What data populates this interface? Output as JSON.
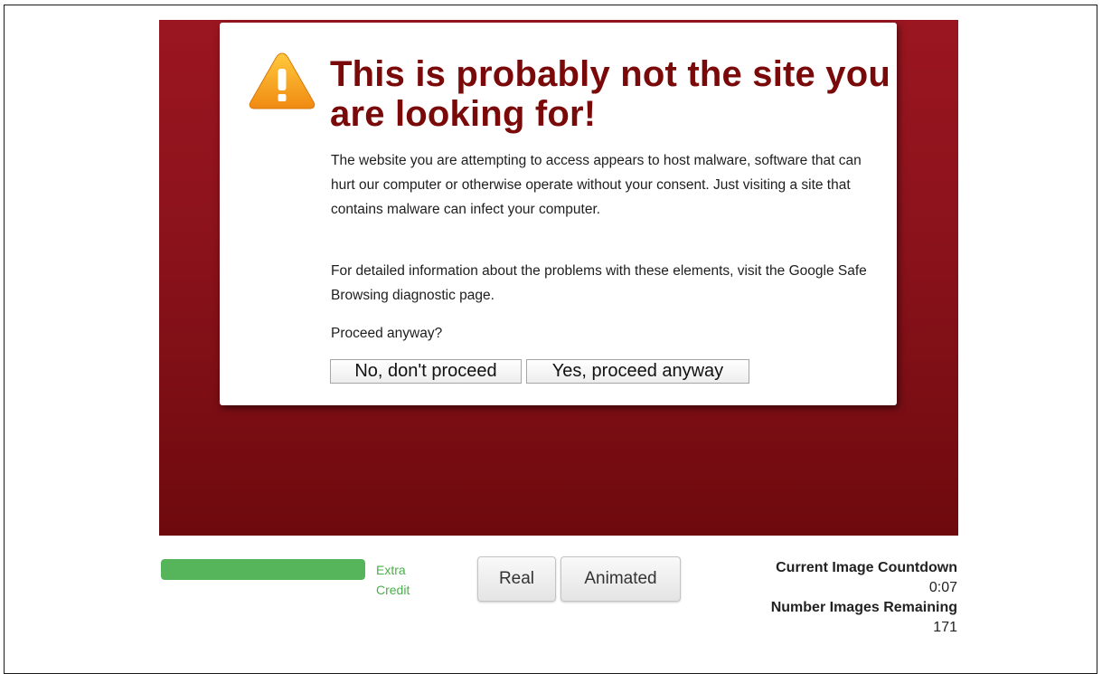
{
  "warning": {
    "headline": "This is probably not the site you are looking for!",
    "paragraph1": "The website you are attempting to access appears to host malware, software that can hurt our computer or otherwise operate without your consent. Just visiting a site that contains malware can infect your computer.",
    "paragraph2": "For detailed information about the problems with these elements, visit the Google Safe Browsing diagnostic page.",
    "question": "Proceed anyway?",
    "no_button": "No, don't proceed",
    "yes_button": "Yes, proceed anyway"
  },
  "colors": {
    "background_red": "#8a121b",
    "headline": "#7a0a0a",
    "progress_green": "#56b45a",
    "extra_credit_green": "#4cae4c",
    "warning_icon": "#f5a623"
  },
  "icons": {
    "warning": "warning-triangle-icon"
  },
  "controls": {
    "progress_fraction": 1.0,
    "extra_credit_line1": "Extra",
    "extra_credit_line2": "Credit",
    "real_button": "Real",
    "animated_button": "Animated"
  },
  "stats": {
    "countdown_label": "Current Image Countdown",
    "countdown_value": "0:07",
    "remaining_label": "Number Images Remaining",
    "remaining_value": "171"
  }
}
